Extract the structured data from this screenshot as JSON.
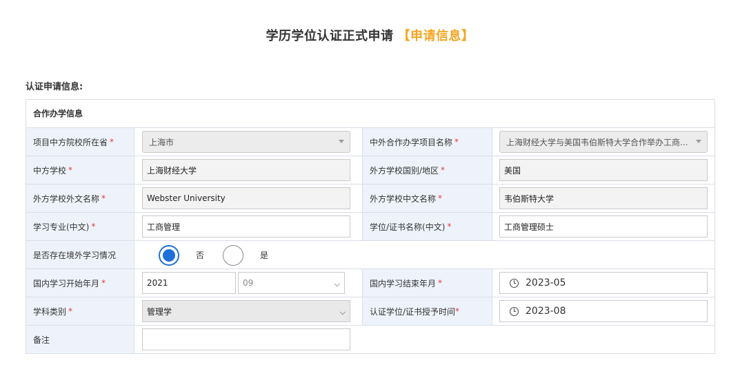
{
  "page": {
    "title": "学历学位认证正式申请",
    "title_accent": "【申请信息】",
    "section_label": "认证申请信息:"
  },
  "colors": {
    "accent": "#f5a623",
    "required": "#e53935",
    "radio_checked": "#1e6fd9",
    "label_bg": "#eef3fb"
  },
  "form": {
    "header": "合作办学信息",
    "province": {
      "label": "项目中方院校所在省",
      "value": "上海市"
    },
    "project_name": {
      "label": "中外合作办学项目名称",
      "value": "上海财经大学与美国韦伯斯特大学合作举办工商..."
    },
    "chinese_school": {
      "label": "中方学校",
      "value": "上海财经大学"
    },
    "foreign_country": {
      "label": "外方学校国别/地区",
      "value": "美国"
    },
    "foreign_name_en": {
      "label": "外方学校外文名称",
      "value": "Webster University"
    },
    "foreign_name_cn": {
      "label": "外方学校中文名称",
      "value": "韦伯斯特大学"
    },
    "major": {
      "label": "学习专业(中文)",
      "value": "工商管理"
    },
    "degree_name": {
      "label": "学位/证书名称(中文)",
      "value": "工商管理硕士"
    },
    "overseas_study": {
      "label": "是否存在境外学习情况",
      "option_no": "否",
      "option_yes": "是"
    },
    "start_date": {
      "label": "国内学习开始年月",
      "year": "2021",
      "month": "09"
    },
    "end_date": {
      "label": "国内学习结束年月",
      "value": "2023-05"
    },
    "discipline": {
      "label": "学科类别",
      "value": "管理学"
    },
    "award_date": {
      "label": "认证学位/证书授予时间",
      "value": "2023-08"
    },
    "remarks": {
      "label": "备注",
      "value": ""
    },
    "required_mark": "*"
  }
}
